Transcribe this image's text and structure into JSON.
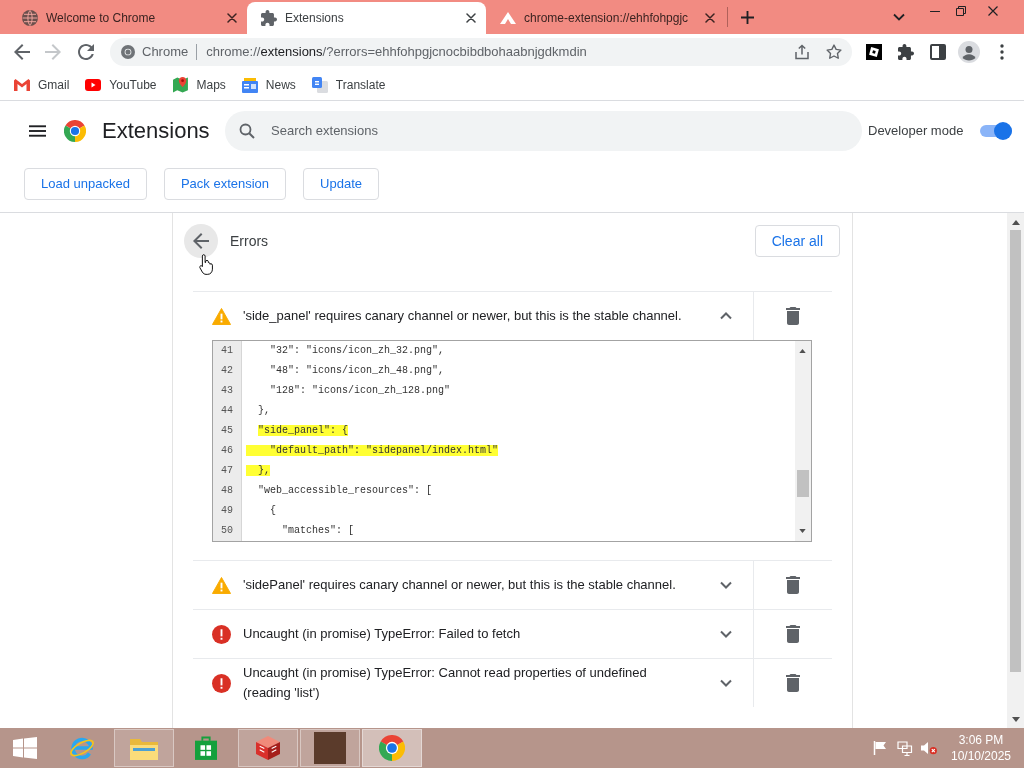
{
  "browser": {
    "tabs": [
      {
        "title": "Welcome to Chrome",
        "selected": false
      },
      {
        "title": "Extensions",
        "selected": true
      },
      {
        "title": "chrome-extension://ehhfohpgjc",
        "selected": false
      }
    ],
    "navigation": [
      {
        "disabled": false
      },
      {
        "disabled": true
      },
      {
        "disabled": false
      }
    ],
    "address_bar": {
      "site_chip": "Chrome",
      "url": {
        "scheme": "chrome://",
        "host": "extensions",
        "path": "/?errors=ehhfohpgjcnocbibdbohaabnjgdkmdin"
      }
    },
    "bookmarks": [
      {
        "label": "Gmail"
      },
      {
        "label": "YouTube"
      },
      {
        "label": "Maps"
      },
      {
        "label": "News"
      },
      {
        "label": "Translate"
      }
    ]
  },
  "extensions_page": {
    "title": "Extensions",
    "search": {
      "placeholder": "Search extensions"
    },
    "developer_mode": {
      "label": "Developer mode",
      "on": true
    },
    "actions": [
      {
        "label": "Load unpacked"
      },
      {
        "label": "Pack extension"
      },
      {
        "label": "Update"
      }
    ],
    "errors_panel": {
      "title": "Errors",
      "clear_all": "Clear all",
      "errors": [
        {
          "kind": "warning",
          "message": "'side_panel' requires canary channel or newer, but this is the stable channel.",
          "expanded": true,
          "code": {
            "lines": [
              {
                "number": "41",
                "text": "    \"32\": \"icons/icon_zh_32.png\",",
                "highlighted": false
              },
              {
                "number": "42",
                "text": "    \"48\": \"icons/icon_zh_48.png\",",
                "highlighted": false
              },
              {
                "number": "43",
                "text": "    \"128\": \"icons/icon_zh_128.png\"",
                "highlighted": false
              },
              {
                "number": "44",
                "text": "  },",
                "highlighted": false
              },
              {
                "number": "45",
                "text": "  \"side_panel\": {",
                "highlighted": true,
                "highlight_starts": true
              },
              {
                "number": "46",
                "text": "    \"default_path\": \"sidepanel/index.html\"",
                "highlighted": true,
                "highlight_starts": false
              },
              {
                "number": "47",
                "text": "  },",
                "highlighted": true,
                "highlight_starts": false
              },
              {
                "number": "48",
                "text": "  \"web_accessible_resources\": [",
                "highlighted": false
              },
              {
                "number": "49",
                "text": "    {",
                "highlighted": false
              },
              {
                "number": "50",
                "text": "      \"matches\": [",
                "highlighted": false
              }
            ]
          }
        },
        {
          "kind": "warning",
          "message": "'sidePanel' requires canary channel or newer, but this is the stable channel.",
          "expanded": false
        },
        {
          "kind": "error",
          "message": "Uncaught (in promise) TypeError: Failed to fetch",
          "expanded": false
        },
        {
          "kind": "error",
          "message": "Uncaught (in promise) TypeError: Cannot read properties of undefined (reading 'list')",
          "expanded": false
        }
      ]
    }
  },
  "taskbar": {
    "apps": [
      {
        "running": false,
        "selected": false
      },
      {
        "running": true,
        "selected": false
      },
      {
        "running": false,
        "selected": false
      },
      {
        "running": true,
        "selected": false
      },
      {
        "running": true,
        "selected": false
      },
      {
        "running": true,
        "selected": true
      }
    ],
    "clock": {
      "time": "3:06 PM",
      "date": "10/10/2025"
    }
  }
}
